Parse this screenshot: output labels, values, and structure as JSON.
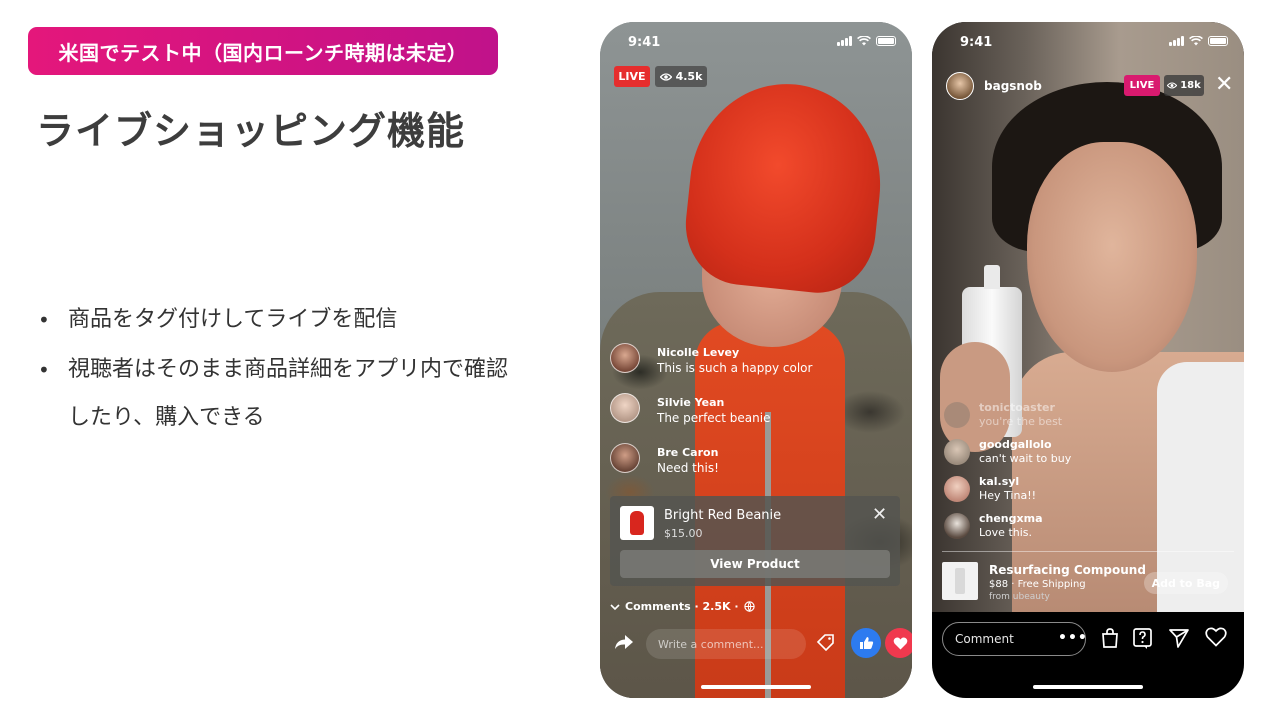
{
  "slide": {
    "badge": "米国でテスト中（国内ローンチ時期は未定）",
    "title": "ライブショッピング機能",
    "bullets": [
      "商品をタグ付けしてライブを配信",
      "視聴者はそのまま商品詳細をアプリ内で確認",
      "したり、購入できる"
    ]
  },
  "colors": {
    "badge_gradient_start": "#e4177b",
    "badge_gradient_end": "#c0128a",
    "live_red": "#e62d2d",
    "live_magenta": "#d91a6f",
    "like_blue": "#2d7bf0",
    "love_red": "#f0394e"
  },
  "phone_left": {
    "time": "9:41",
    "live_label": "LIVE",
    "viewers": "4.5k",
    "comments": [
      {
        "name": "Nicolle Levey",
        "text": "This is such a happy color",
        "avatar_color": "#7a4a3a"
      },
      {
        "name": "Silvie Yean",
        "text": "The perfect beanie",
        "avatar_color": "#b69a8a"
      },
      {
        "name": "Bre Caron",
        "text": "Need this!",
        "avatar_color": "#6a4638"
      }
    ],
    "product": {
      "name": "Bright Red Beanie",
      "price": "$15.00",
      "cta": "View Product"
    },
    "comments_summary": "Comments · 2.5K ·",
    "comment_placeholder": "Write a comment..."
  },
  "phone_right": {
    "time": "9:41",
    "host": "bagsnob",
    "live_label": "LIVE",
    "viewers": "18k",
    "comments": [
      {
        "name": "tonictoaster",
        "text": "you're the best",
        "avatar_color": "#8a7c70",
        "faded": true
      },
      {
        "name": "goodgallolo",
        "text": "can't wait to buy",
        "avatar_color": "#9c8d7e",
        "faded": false
      },
      {
        "name": "kal.syl",
        "text": "Hey Tina!!",
        "avatar_color": "#d8b0a0",
        "faded": false
      },
      {
        "name": "chengxma",
        "text": "Love this.",
        "avatar_color": "#5a4a40",
        "faded": false
      }
    ],
    "product": {
      "name": "Resurfacing Compound",
      "price": "$88 · Free Shipping",
      "seller": "from ubeauty",
      "cta": "Add to Bag"
    },
    "comment_placeholder": "Comment"
  }
}
